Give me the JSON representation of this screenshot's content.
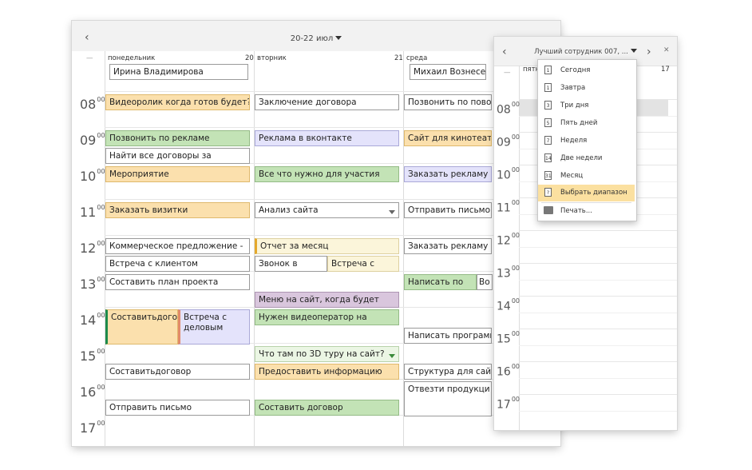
{
  "main": {
    "title": "20-22 июл",
    "days": [
      {
        "name": "понедельник",
        "num": "20",
        "resource": "Ирина Владимирова"
      },
      {
        "name": "вторник",
        "num": "21",
        "resource": ""
      },
      {
        "name": "среда",
        "num": "",
        "resource": "Михаил Вознесен"
      }
    ],
    "hours": [
      "08",
      "09",
      "10",
      "11",
      "12",
      "13",
      "14",
      "15",
      "16",
      "17"
    ],
    "minutes": "00",
    "appointments": {
      "a1": "Видеоролик когда готов будет?",
      "a2": "Позвонить по рекламе",
      "a3": "Найти все договоры за",
      "a4": "Мероприятие",
      "a5": "Заказать визитки",
      "a6": "Коммерческое предложение -",
      "a7": "Встреча с клиентом",
      "a8": "Составить план проекта",
      "a9": "Составитьдоговор",
      "a10": "Встреча с деловым",
      "a11": "Составитьдоговор",
      "a12": "Отправить письмо",
      "b1": "Заключение договора",
      "b2": "Реклама в вконтакте",
      "b3": "Все что нужно для участия",
      "b4": "Анализ сайта",
      "b5": "Отчет за месяц",
      "b6": "Звонок в",
      "b7": "Встреча с",
      "b8": "Меню на сайт, когда будет",
      "b9": "Нужен видеоператор на",
      "b10": "Что там по 3D туру на сайт?",
      "b11": "Предоставить информацию",
      "b12": "Составить договор",
      "c1": "Позвонить по повод",
      "c2": "Сайт для кинотеатр",
      "c3": "Заказать рекламу",
      "c4": "Отправить письмо",
      "c5": "Заказать рекламу",
      "c6": "Написать по",
      "c7": "Во",
      "c8": "Написать программ",
      "c9": "Структура для сайт",
      "c10": "Отвезти продукци"
    }
  },
  "side": {
    "title": "Лучший сотрудник 007, ...",
    "day_label": "пятн",
    "day_num": "17",
    "hours": [
      "08",
      "09",
      "10",
      "11",
      "12",
      "13",
      "14",
      "15",
      "16",
      "17"
    ],
    "minutes": "00"
  },
  "menu": {
    "items": [
      {
        "label": "Сегодня",
        "icon": "1"
      },
      {
        "label": "Завтра",
        "icon": "1"
      },
      {
        "label": "Три дня",
        "icon": "3"
      },
      {
        "label": "Пять дней",
        "icon": "5"
      },
      {
        "label": "Неделя",
        "icon": "7"
      },
      {
        "label": "Две недели",
        "icon": "14"
      },
      {
        "label": "Месяц",
        "icon": "31"
      },
      {
        "label": "Выбрать диапазон",
        "icon": "?"
      }
    ],
    "print": "Печать..."
  }
}
